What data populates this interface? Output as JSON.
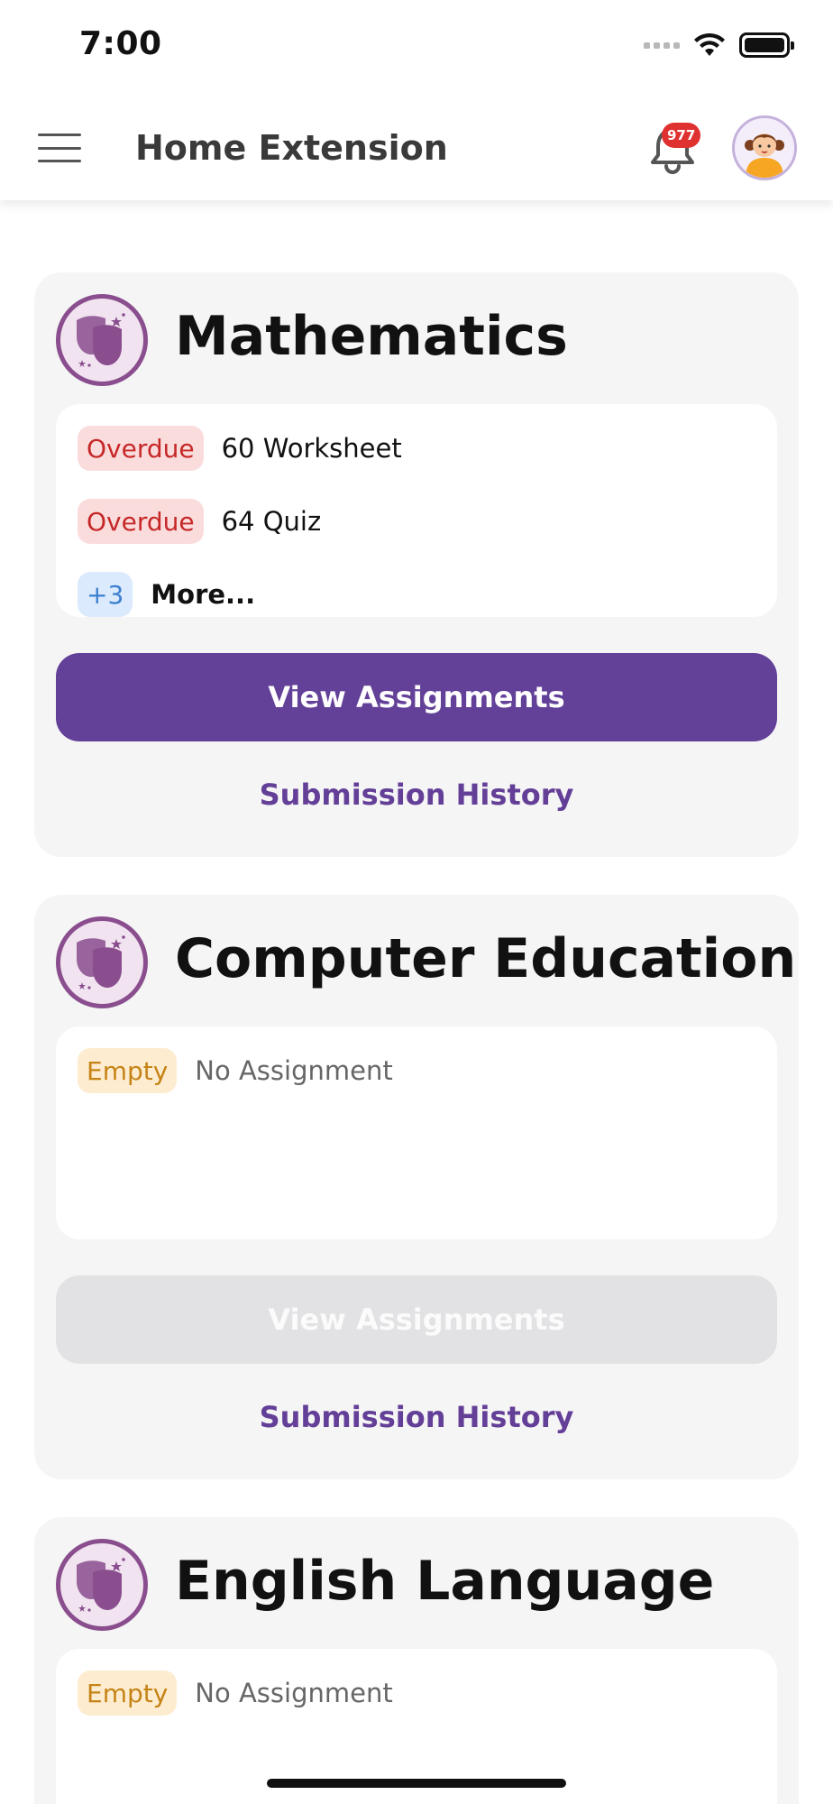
{
  "status_bar": {
    "time": "7:00"
  },
  "header": {
    "title": "Home Extension",
    "notification_count": "977",
    "icons": [
      "menu-icon",
      "bell-icon",
      "avatar"
    ]
  },
  "colors": {
    "primary": "#634198",
    "overdue_bg": "#fbdcdc",
    "overdue_text": "#c62828",
    "empty_bg": "#fdecd0",
    "empty_text": "#c68316",
    "more_bg": "#dbeafd",
    "more_text": "#3b7fd0",
    "notification_badge": "#e03131"
  },
  "subjects": [
    {
      "name": "Mathematics",
      "items": [
        {
          "status": "Overdue",
          "text": "60 Worksheet"
        },
        {
          "status": "Overdue",
          "text": "64 Quiz"
        }
      ],
      "more": {
        "count": "+3",
        "label": "More..."
      },
      "view_button": "View Assignments",
      "view_enabled": true,
      "history_link": "Submission History"
    },
    {
      "name": "Computer Education",
      "items": [
        {
          "status": "Empty",
          "text": "No Assignment"
        }
      ],
      "view_button": "View Assignments",
      "view_enabled": false,
      "history_link": "Submission History"
    },
    {
      "name": "English Language",
      "items": [
        {
          "status": "Empty",
          "text": "No Assignment"
        }
      ]
    }
  ]
}
